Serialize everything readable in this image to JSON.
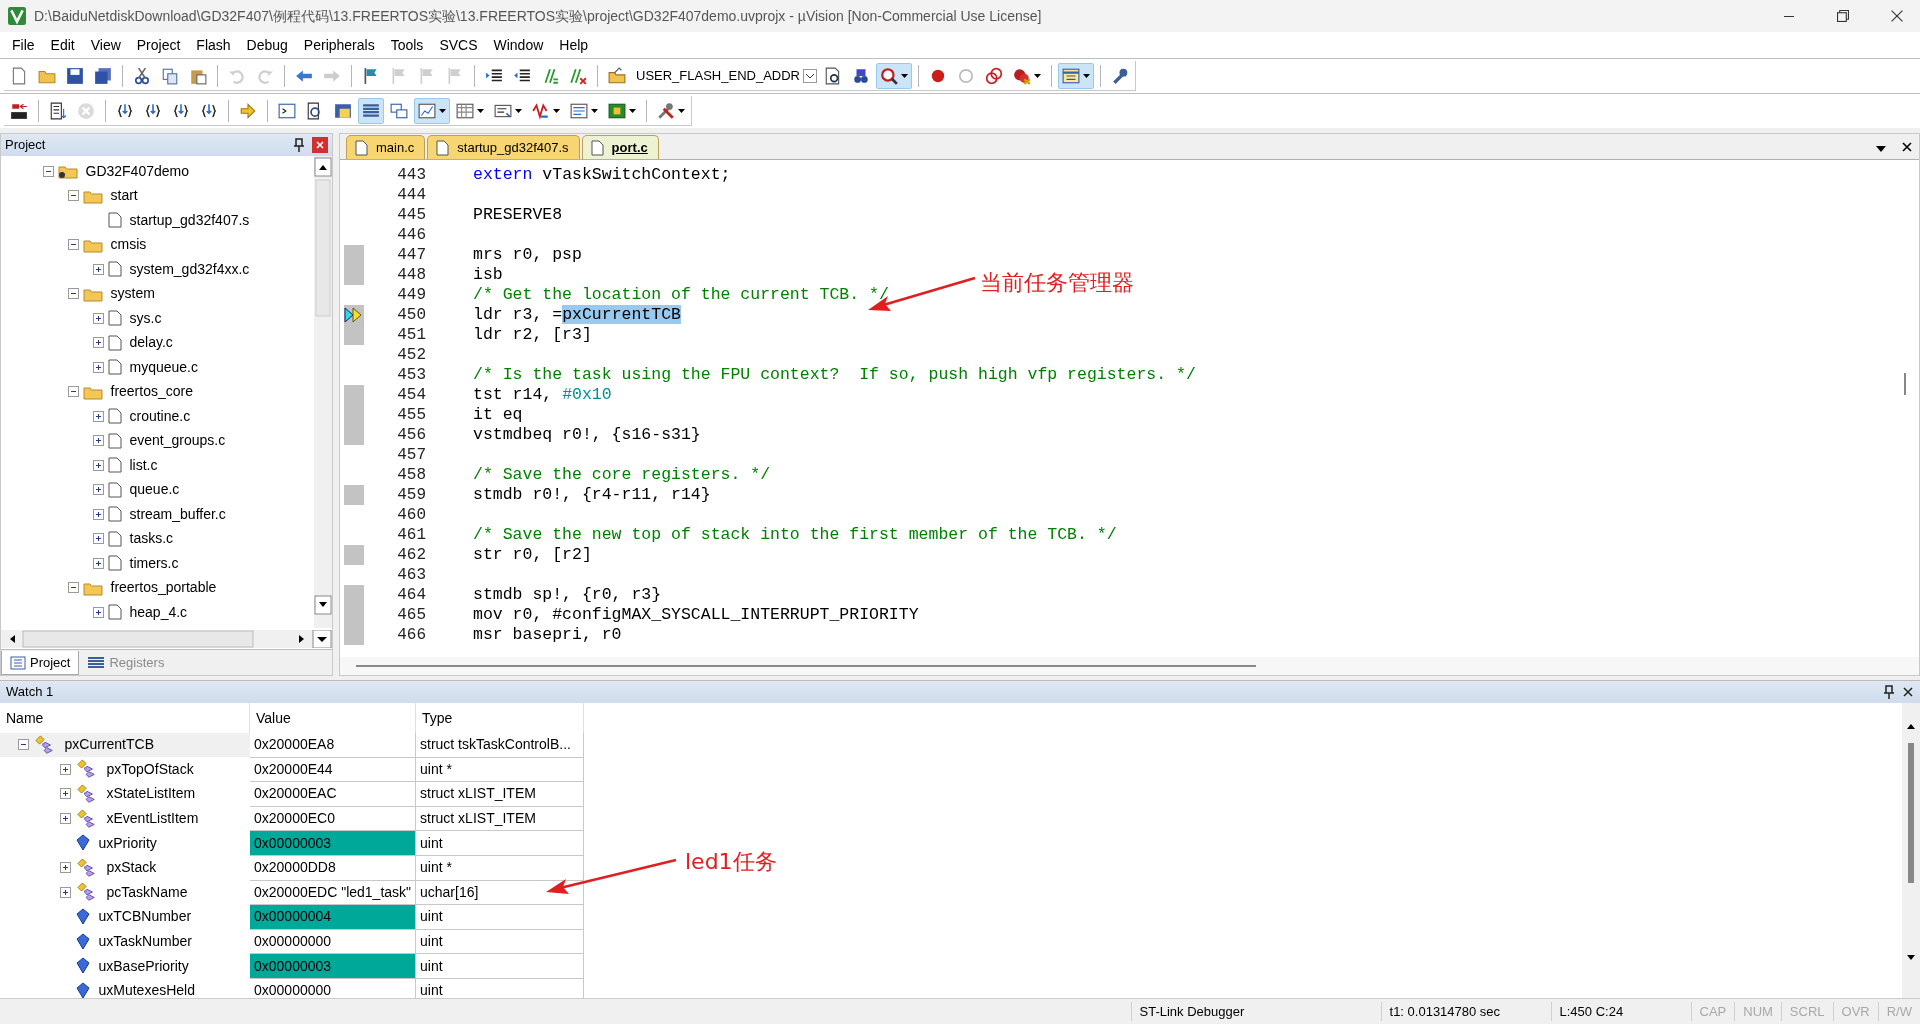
{
  "window": {
    "title": "D:\\BaiduNetdiskDownload\\GD32F407\\例程代码\\13.FREERTOS实验\\13.FREERTOS实验\\project\\GD32F407demo.uvprojx - µVision  [Non-Commercial Use License]"
  },
  "menu": [
    "File",
    "Edit",
    "View",
    "Project",
    "Flash",
    "Debug",
    "Peripherals",
    "Tools",
    "SVCS",
    "Window",
    "Help"
  ],
  "toolbar_1": [
    {
      "kind": "button",
      "disabled": false,
      "pressed": false
    },
    {
      "kind": "button",
      "disabled": false,
      "pressed": false
    },
    {
      "kind": "button",
      "disabled": false,
      "pressed": false
    },
    {
      "kind": "button",
      "disabled": false,
      "pressed": false
    },
    {
      "kind": "separator"
    },
    {
      "kind": "button",
      "disabled": false,
      "pressed": false
    },
    {
      "kind": "button",
      "disabled": false,
      "pressed": false
    },
    {
      "kind": "button",
      "disabled": false,
      "pressed": false
    },
    {
      "kind": "separator"
    },
    {
      "kind": "button",
      "disabled": true,
      "pressed": false
    },
    {
      "kind": "button",
      "disabled": true,
      "pressed": false
    },
    {
      "kind": "separator"
    },
    {
      "kind": "button",
      "disabled": false,
      "pressed": false
    },
    {
      "kind": "button",
      "disabled": true,
      "pressed": false
    },
    {
      "kind": "separator"
    },
    {
      "kind": "button",
      "disabled": false,
      "pressed": false
    },
    {
      "kind": "button",
      "disabled": true,
      "pressed": false
    },
    {
      "kind": "button",
      "disabled": true,
      "pressed": false
    },
    {
      "kind": "button",
      "disabled": true,
      "pressed": false
    },
    {
      "kind": "separator"
    },
    {
      "kind": "button",
      "disabled": false,
      "pressed": false
    },
    {
      "kind": "button",
      "disabled": false,
      "pressed": false
    },
    {
      "kind": "button",
      "disabled": false,
      "pressed": false
    },
    {
      "kind": "button",
      "disabled": false,
      "pressed": false
    },
    {
      "kind": "separator"
    },
    {
      "kind": "button",
      "disabled": false,
      "pressed": false
    },
    {
      "kind": "combo",
      "value": "USER_FLASH_END_ADDR"
    },
    {
      "kind": "button",
      "disabled": false,
      "pressed": false
    },
    {
      "kind": "button",
      "disabled": false,
      "pressed": false
    },
    {
      "kind": "split",
      "disabled": false,
      "pressed": true
    },
    {
      "kind": "separator"
    },
    {
      "kind": "button",
      "disabled": false,
      "pressed": false
    },
    {
      "kind": "button",
      "disabled": false,
      "pressed": false
    },
    {
      "kind": "button",
      "disabled": false,
      "pressed": false
    },
    {
      "kind": "split",
      "disabled": false,
      "pressed": false
    },
    {
      "kind": "separator"
    },
    {
      "kind": "split",
      "disabled": false,
      "pressed": true
    },
    {
      "kind": "separator"
    },
    {
      "kind": "button",
      "disabled": false,
      "pressed": false
    }
  ],
  "toolbar_2": [
    {
      "kind": "button",
      "disabled": false,
      "pressed": false
    },
    {
      "kind": "separator"
    },
    {
      "kind": "button",
      "disabled": false,
      "pressed": false
    },
    {
      "kind": "button",
      "disabled": true,
      "pressed": false
    },
    {
      "kind": "separator"
    },
    {
      "kind": "button",
      "disabled": false,
      "pressed": false
    },
    {
      "kind": "button",
      "disabled": false,
      "pressed": false
    },
    {
      "kind": "button",
      "disabled": false,
      "pressed": false
    },
    {
      "kind": "button",
      "disabled": false,
      "pressed": false
    },
    {
      "kind": "separator"
    },
    {
      "kind": "button",
      "disabled": false,
      "pressed": false
    },
    {
      "kind": "separator"
    },
    {
      "kind": "button",
      "disabled": false,
      "pressed": false
    },
    {
      "kind": "button",
      "disabled": false,
      "pressed": false
    },
    {
      "kind": "button",
      "disabled": false,
      "pressed": false
    },
    {
      "kind": "button",
      "disabled": false,
      "pressed": true
    },
    {
      "kind": "button",
      "disabled": false,
      "pressed": false
    },
    {
      "kind": "split",
      "disabled": false,
      "pressed": true
    },
    {
      "kind": "split",
      "disabled": false,
      "pressed": false
    },
    {
      "kind": "split",
      "disabled": false,
      "pressed": false
    },
    {
      "kind": "split",
      "disabled": false,
      "pressed": false
    },
    {
      "kind": "split",
      "disabled": false,
      "pressed": false
    },
    {
      "kind": "split",
      "disabled": false,
      "pressed": false
    },
    {
      "kind": "separator"
    },
    {
      "kind": "split",
      "disabled": false,
      "pressed": false
    }
  ],
  "project_panel": {
    "title": "Project",
    "tree": [
      {
        "label": "GD32F407demo",
        "kind": "target",
        "expanded": true,
        "children": [
          {
            "label": "start",
            "kind": "group",
            "expanded": true,
            "children": [
              {
                "label": "startup_gd32f407.s",
                "kind": "file"
              }
            ]
          },
          {
            "label": "cmsis",
            "kind": "group",
            "expanded": true,
            "children": [
              {
                "label": "system_gd32f4xx.c",
                "kind": "file",
                "expanded": false
              }
            ]
          },
          {
            "label": "system",
            "kind": "group",
            "expanded": true,
            "children": [
              {
                "label": "sys.c",
                "kind": "file",
                "expanded": false
              },
              {
                "label": "delay.c",
                "kind": "file",
                "expanded": false
              },
              {
                "label": "myqueue.c",
                "kind": "file",
                "expanded": false
              }
            ]
          },
          {
            "label": "freertos_core",
            "kind": "group",
            "expanded": true,
            "children": [
              {
                "label": "croutine.c",
                "kind": "file",
                "expanded": false
              },
              {
                "label": "event_groups.c",
                "kind": "file",
                "expanded": false
              },
              {
                "label": "list.c",
                "kind": "file",
                "expanded": false
              },
              {
                "label": "queue.c",
                "kind": "file",
                "expanded": false
              },
              {
                "label": "stream_buffer.c",
                "kind": "file",
                "expanded": false
              },
              {
                "label": "tasks.c",
                "kind": "file",
                "expanded": false
              },
              {
                "label": "timers.c",
                "kind": "file",
                "expanded": false
              }
            ]
          },
          {
            "label": "freertos_portable",
            "kind": "group",
            "expanded": true,
            "children": [
              {
                "label": "heap_4.c",
                "kind": "file",
                "expanded": false
              }
            ]
          }
        ]
      }
    ],
    "tabs": [
      {
        "label": "Project",
        "selected": true
      },
      {
        "label": "Registers",
        "selected": false
      }
    ]
  },
  "editor": {
    "tabs": [
      {
        "label": "main.c",
        "selected": false
      },
      {
        "label": "startup_gd32f407.s",
        "selected": false
      },
      {
        "label": "port.c",
        "selected": true
      }
    ],
    "lines": [
      {
        "number": "443",
        "executable": false,
        "current": false,
        "parts": [
          {
            "text": "extern",
            "kind": "keyword"
          },
          {
            "text": " vTaskSwitchContext;",
            "kind": "plain"
          }
        ]
      },
      {
        "number": "444",
        "executable": false,
        "current": false
      },
      {
        "number": "445",
        "executable": false,
        "current": false,
        "parts": [
          {
            "text": "PRESERVE8",
            "kind": "plain"
          }
        ]
      },
      {
        "number": "446",
        "executable": false,
        "current": false
      },
      {
        "number": "447",
        "executable": true,
        "current": false,
        "parts": [
          {
            "text": "mrs r0, psp",
            "kind": "plain"
          }
        ]
      },
      {
        "number": "448",
        "executable": true,
        "current": false,
        "parts": [
          {
            "text": "isb",
            "kind": "plain"
          }
        ]
      },
      {
        "number": "449",
        "executable": false,
        "current": false,
        "parts": [
          {
            "text": "/* Get the location of the current TCB. */",
            "kind": "comment"
          }
        ]
      },
      {
        "number": "450",
        "executable": true,
        "current": true,
        "parts": [
          {
            "text": "ldr r3, =",
            "kind": "plain"
          },
          {
            "text": "pxCurrentTCB",
            "kind": "selection"
          }
        ]
      },
      {
        "number": "451",
        "executable": true,
        "current": false,
        "parts": [
          {
            "text": "ldr r2, [r3]",
            "kind": "plain"
          }
        ]
      },
      {
        "number": "452",
        "executable": false,
        "current": false
      },
      {
        "number": "453",
        "executable": false,
        "current": false,
        "parts": [
          {
            "text": "/* Is the task using the FPU context?  If so, push high vfp registers. */",
            "kind": "comment"
          }
        ]
      },
      {
        "number": "454",
        "executable": true,
        "current": false,
        "parts": [
          {
            "text": "tst r14, ",
            "kind": "plain"
          },
          {
            "text": "#0x10",
            "kind": "number"
          }
        ]
      },
      {
        "number": "455",
        "executable": true,
        "current": false,
        "parts": [
          {
            "text": "it eq",
            "kind": "plain"
          }
        ]
      },
      {
        "number": "456",
        "executable": true,
        "current": false,
        "parts": [
          {
            "text": "vstmdbeq r0!, {s16-s31}",
            "kind": "plain"
          }
        ]
      },
      {
        "number": "457",
        "executable": false,
        "current": false
      },
      {
        "number": "458",
        "executable": false,
        "current": false,
        "parts": [
          {
            "text": "/* Save the core registers. */",
            "kind": "comment"
          }
        ]
      },
      {
        "number": "459",
        "executable": true,
        "current": false,
        "parts": [
          {
            "text": "stmdb r0!, {r4-r11, r14}",
            "kind": "plain"
          }
        ]
      },
      {
        "number": "460",
        "executable": false,
        "current": false
      },
      {
        "number": "461",
        "executable": false,
        "current": false,
        "parts": [
          {
            "text": "/* Save the new top of stack into the first member of the TCB. */",
            "kind": "comment"
          }
        ]
      },
      {
        "number": "462",
        "executable": true,
        "current": false,
        "parts": [
          {
            "text": "str r0, [r2]",
            "kind": "plain"
          }
        ]
      },
      {
        "number": "463",
        "executable": false,
        "current": false
      },
      {
        "number": "464",
        "executable": true,
        "current": false,
        "parts": [
          {
            "text": "stmdb sp!, {r0, r3}",
            "kind": "plain"
          }
        ]
      },
      {
        "number": "465",
        "executable": true,
        "current": false,
        "parts": [
          {
            "text": "mov r0, #configMAX_SYSCALL_INTERRUPT_PRIORITY",
            "kind": "plain"
          }
        ]
      },
      {
        "number": "466",
        "executable": true,
        "current": false,
        "parts": [
          {
            "text": "msr basepri, r0",
            "kind": "plain"
          }
        ]
      }
    ]
  },
  "annotations": [
    {
      "text": "当前任务管理器"
    },
    {
      "text": "led1任务"
    }
  ],
  "watch": {
    "title": "Watch 1",
    "columns": [
      "Name",
      "Value",
      "Type"
    ],
    "rows": [
      {
        "name": "pxCurrentTCB",
        "value": "0x20000EA8",
        "type": "struct tskTaskControlB...",
        "kind": "struct",
        "expanded": true,
        "changed": false,
        "children": [
          {
            "name": "pxTopOfStack",
            "value": "0x20000E44",
            "type": "uint *",
            "kind": "struct",
            "expanded": false,
            "changed": false
          },
          {
            "name": "xStateListItem",
            "value": "0x20000EAC",
            "type": "struct xLIST_ITEM",
            "kind": "struct",
            "expanded": false,
            "changed": false
          },
          {
            "name": "xEventListItem",
            "value": "0x20000EC0",
            "type": "struct xLIST_ITEM",
            "kind": "struct",
            "expanded": false,
            "changed": false
          },
          {
            "name": "uxPriority",
            "value": "0x00000003",
            "type": "uint",
            "kind": "scalar",
            "changed": true
          },
          {
            "name": "pxStack",
            "value": "0x20000DD8",
            "type": "uint *",
            "kind": "struct",
            "expanded": false,
            "changed": false
          },
          {
            "name": "pcTaskName",
            "value": "0x20000EDC \"led1_task\"",
            "type": "uchar[16]",
            "kind": "struct",
            "expanded": false,
            "changed": false
          },
          {
            "name": "uxTCBNumber",
            "value": "0x00000004",
            "type": "uint",
            "kind": "scalar",
            "changed": true
          },
          {
            "name": "uxTaskNumber",
            "value": "0x00000000",
            "type": "uint",
            "kind": "scalar",
            "changed": false
          },
          {
            "name": "uxBasePriority",
            "value": "0x00000003",
            "type": "uint",
            "kind": "scalar",
            "changed": true
          },
          {
            "name": "uxMutexesHeld",
            "value": "0x00000000",
            "type": "uint",
            "kind": "scalar",
            "changed": false
          }
        ]
      }
    ]
  },
  "status_bar": {
    "debugger": "ST-Link Debugger",
    "time": "t1: 0.01314780 sec",
    "position": "L:450 C:24",
    "indicators": [
      {
        "text": "CAP",
        "on": false
      },
      {
        "text": "NUM",
        "on": false
      },
      {
        "text": "SCRL",
        "on": false
      },
      {
        "text": "OVR",
        "on": false
      },
      {
        "text": "R/W",
        "on": false
      }
    ]
  }
}
